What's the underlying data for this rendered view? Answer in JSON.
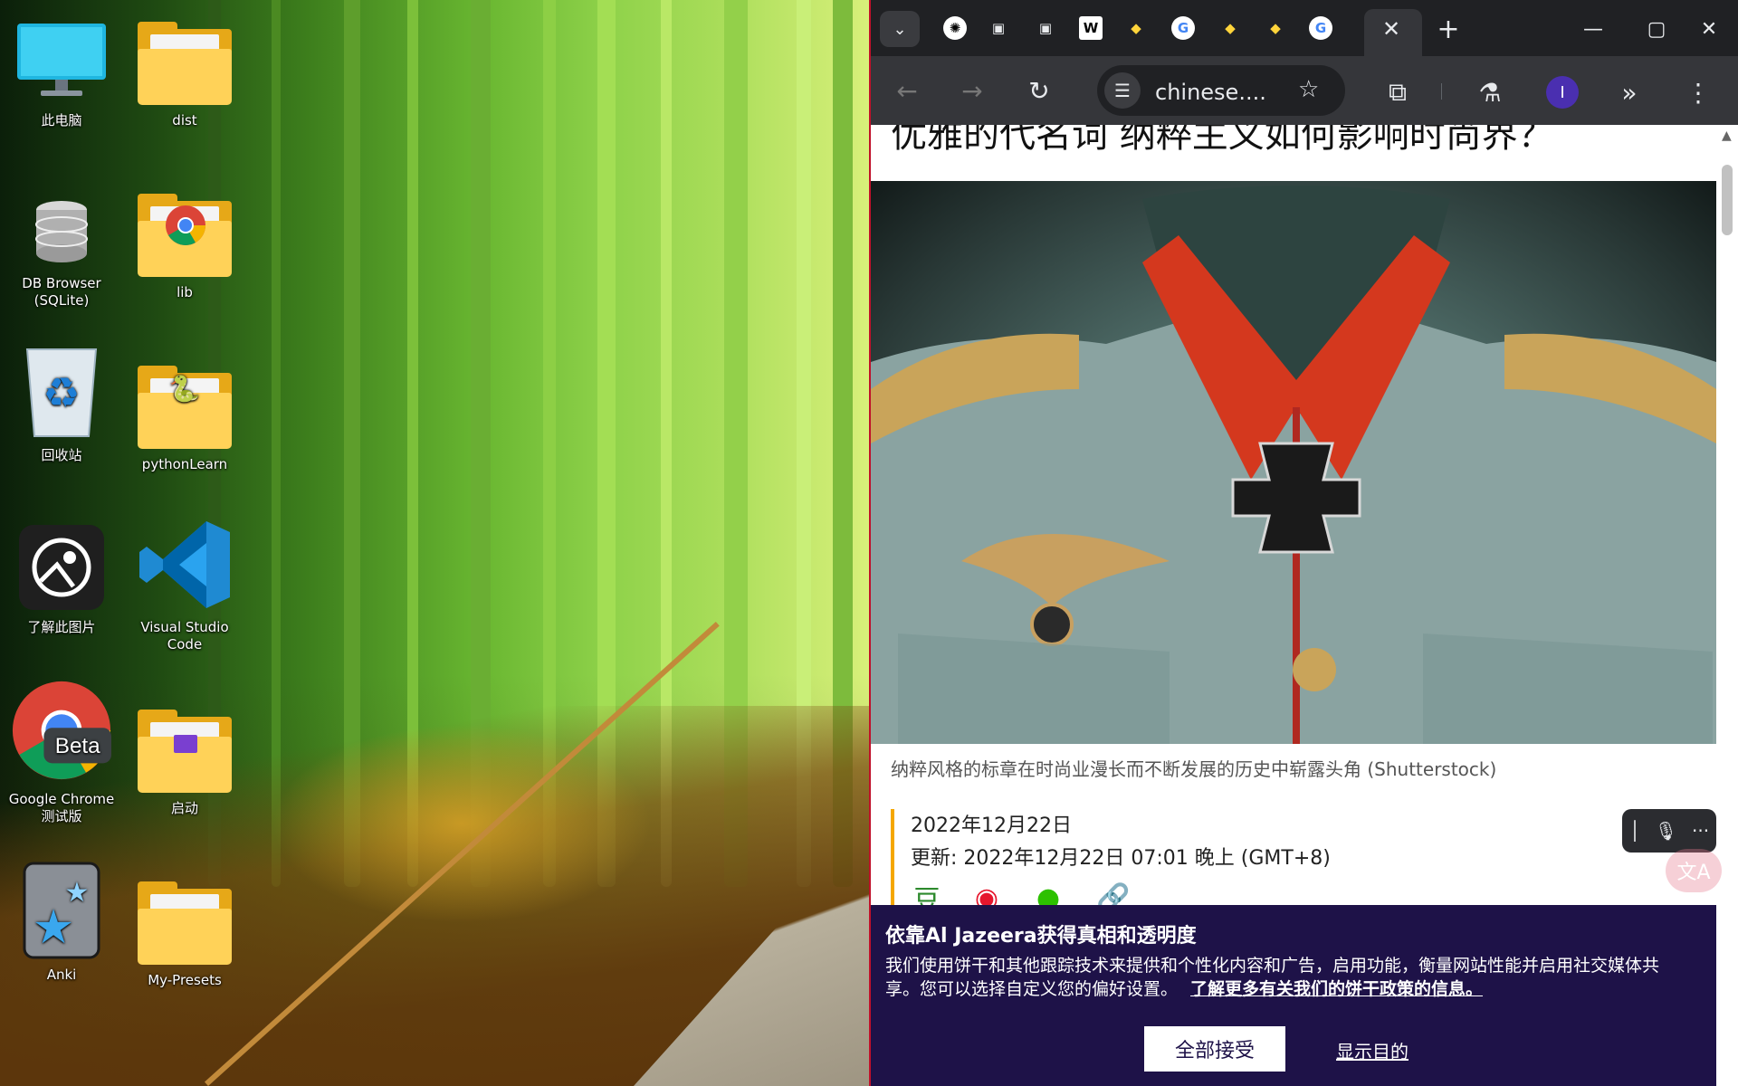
{
  "desktop": {
    "icons": [
      {
        "label": "此电脑",
        "icon": "monitor-icon"
      },
      {
        "label": "dist",
        "icon": "folder-icon"
      },
      {
        "label": "DB Browser\n(SQLite)",
        "icon": "database-icon"
      },
      {
        "label": "lib",
        "icon": "folder-icon"
      },
      {
        "label": "回收站",
        "icon": "recycle-bin-icon"
      },
      {
        "label": "pythonLearn",
        "icon": "folder-icon"
      },
      {
        "label": "了解此图片",
        "icon": "camera-icon"
      },
      {
        "label": "Visual Studio\nCode",
        "icon": "vscode-icon"
      },
      {
        "label": "Google Chrome\n测试版",
        "icon": "chrome-beta-icon"
      },
      {
        "label": "启动",
        "icon": "folder-icon"
      },
      {
        "label": "Anki",
        "icon": "anki-icon"
      },
      {
        "label": "My-Presets",
        "icon": "folder-icon"
      }
    ],
    "chrome_beta_badge": "Beta"
  },
  "browser": {
    "tabs": [
      {
        "icon": "openai-icon"
      },
      {
        "icon": "book-icon"
      },
      {
        "icon": "book-icon"
      },
      {
        "icon": "wikipedia-icon",
        "glyph": "W"
      },
      {
        "icon": "python-icon"
      },
      {
        "icon": "google-icon",
        "glyph": "G"
      },
      {
        "icon": "python-icon"
      },
      {
        "icon": "python-icon"
      },
      {
        "icon": "google-icon",
        "glyph": "G"
      }
    ],
    "omnibox_url": "chinese....",
    "avatar_initial": "I",
    "accent_color": "#c0102a"
  },
  "article": {
    "title": "优雅的代名词 纳粹主义如何影响时尚界？",
    "caption": "纳粹风格的标章在时尚业漫长而不断发展的历史中崭露头角 (Shutterstock)",
    "date": "2022年12月22日",
    "updated": "更新: 2022年12月22日 07:01 晚上 (GMT+8)"
  },
  "cookie_banner": {
    "title": "依靠Al Jazeera获得真相和透明度",
    "text": "我们使用饼干和其他跟踪技术来提供和个性化内容和广告，启用功能，衡量网站性能并启用社交媒体共享。您可以选择自定义您的偏好设置。",
    "link": "了解更多有关我们的饼干政策的信息。",
    "accept": "全部接受",
    "show_purposes": "显示目的",
    "bg_color": "#1e1248"
  }
}
